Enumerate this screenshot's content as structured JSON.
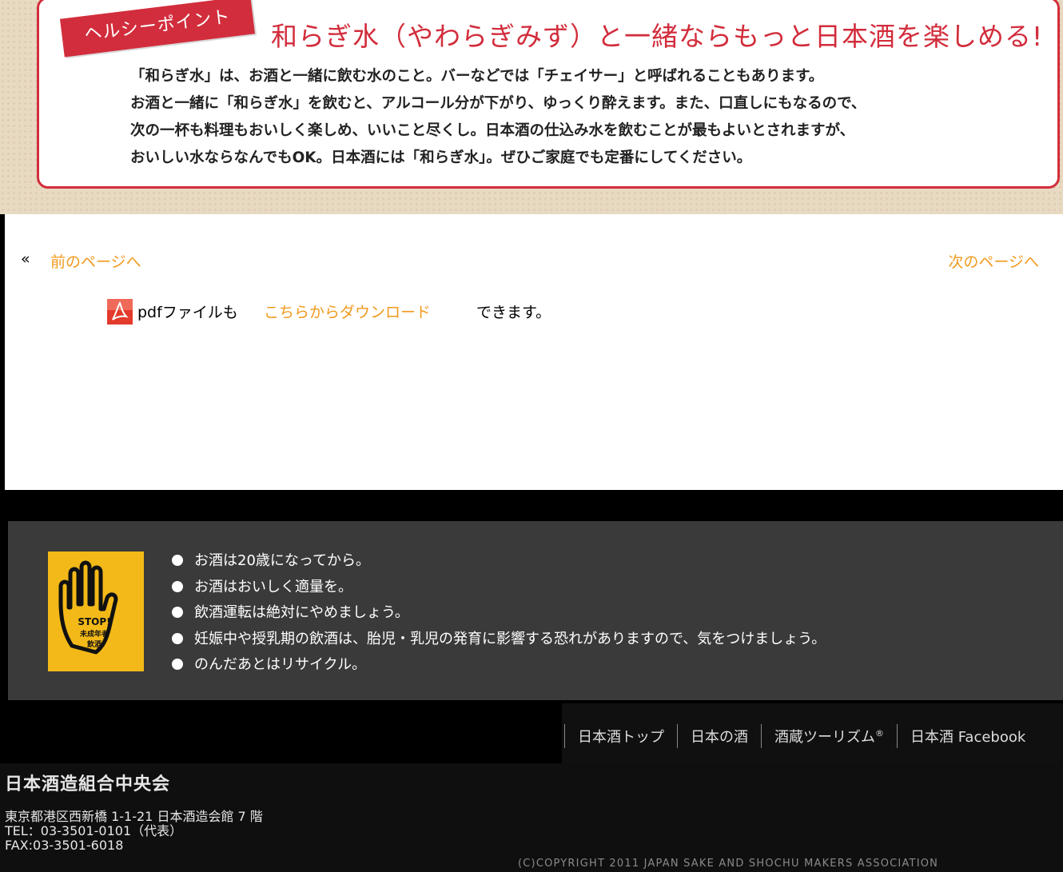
{
  "hero": {
    "tag": "ヘルシーポイント",
    "headline": "和らぎ水（やわらぎみず）と一緒ならもっと日本酒を楽しめる!",
    "lines": [
      "「和らぎ水」は、お酒と一緒に飲む水のこと。バーなどでは「チェイサー」と呼ばれることもあります。",
      "お酒と一緒に「和らぎ水」を飲むと、アルコール分が下がり、ゆっくり酔えます。また、口直しにもなるので、",
      "次の一杯も料理もおいしく楽しめ、いいこと尽くし。日本酒の仕込み水を飲むことが最もよいとされますが、",
      "おいしい水ならなんでもOK。日本酒には「和らぎ水」。ぜひご家庭でも定番にしてください。"
    ]
  },
  "pager": {
    "raquo": "«",
    "prev": "前のページへ",
    "next": "次のページへ"
  },
  "pdf": {
    "icon": "pdf-icon",
    "prefix": "pdfファイルも",
    "link": "こちらからダウンロード",
    "suffix": "できます。"
  },
  "warnings": {
    "badge": {
      "line1": "STOP!",
      "line2": "未成年者",
      "line3": "飲酒"
    },
    "items": [
      "お酒は20歳になってから。",
      "お酒はおいしく適量を。",
      "飲酒運転は絶対にやめましょう。",
      "妊娠中や授乳期の飲酒は、胎児・乳児の発育に影響する恐れがありますので、気をつけましょう。",
      "のんだあとはリサイクル。"
    ]
  },
  "footer": {
    "nav": [
      "日本酒トップ",
      "日本の酒",
      "酒蔵ツーリズム",
      "日本酒 Facebook"
    ],
    "nav_mark": "®",
    "org_name": "日本酒造組合中央会",
    "address": "東京都港区西新橋 1-1-21 日本酒造会館 7 階",
    "tel": "TEL：03-3501-0101（代表）",
    "fax": "FAX:03-3501-6018",
    "copyright": "(C)COPYRIGHT 2011 JAPAN SAKE AND SHOCHU MAKERS ASSOCIATION"
  }
}
